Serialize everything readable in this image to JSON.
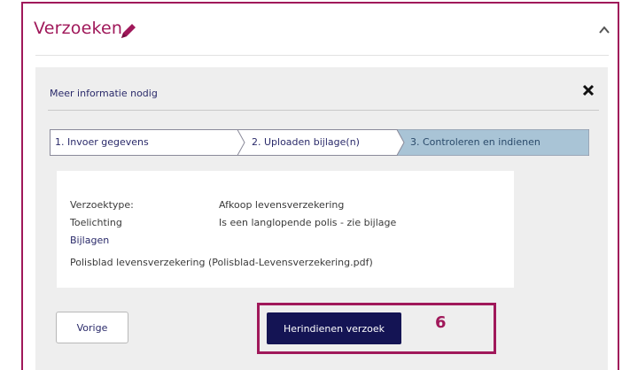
{
  "panel": {
    "title": "Verzoeken",
    "edit_icon": "pencil-icon",
    "collapse_icon": "chevron-up-icon",
    "accent_color": "#a0185a"
  },
  "request_form": {
    "title": "Meer informatie nodig",
    "close_icon": "close-icon",
    "steps": [
      {
        "label": "1. Invoer gegevens",
        "active": false
      },
      {
        "label": "2. Uploaden bijlage(n)",
        "active": false
      },
      {
        "label": "3. Controleren en indienen",
        "active": true
      }
    ],
    "summary": {
      "type_label": "Verzoektype:",
      "type_value": "Afkoop levensverzekering",
      "explanation_label": "Toelichting",
      "explanation_value": "Is een langlopende polis - zie bijlage",
      "attachments_label": "Bijlagen",
      "attachment_file": "Polisblad levensverzekering (Polisblad-Levensverzekering.pdf)"
    },
    "buttons": {
      "previous": "Vorige",
      "resubmit": "Herindienen verzoek"
    },
    "annotation_number": "6"
  },
  "colors": {
    "primary_button": "#141454",
    "active_step": "#a9c4d6",
    "highlight_border": "#a0185a"
  }
}
